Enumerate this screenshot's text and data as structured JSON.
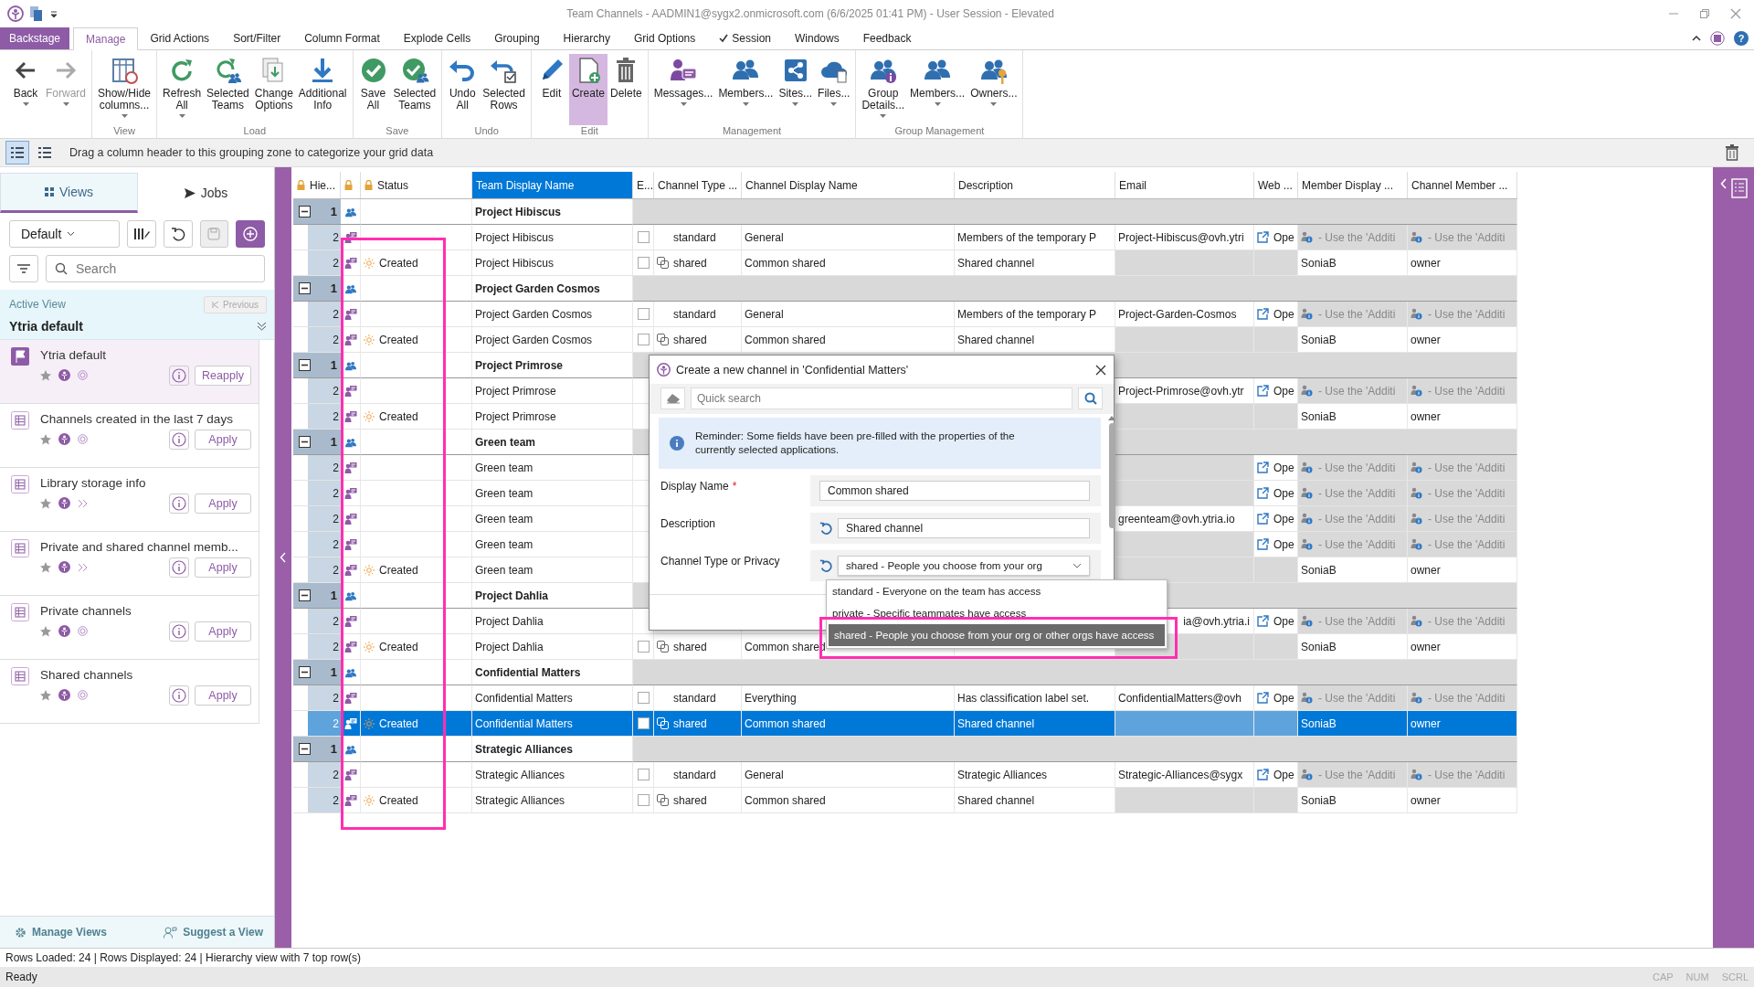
{
  "window": {
    "title": "Team Channels - AADMIN1@sygx2.onmicrosoft.com (6/6/2025 01:41 PM) - User Session - Elevated"
  },
  "menu_tabs": [
    {
      "label": "Backstage",
      "kind": "backstage"
    },
    {
      "label": "Manage",
      "kind": "tab",
      "selected": true
    },
    {
      "label": "Grid Actions",
      "kind": "tab",
      "selected": false
    },
    {
      "label": "Sort/Filter",
      "kind": "tab",
      "selected": false
    },
    {
      "label": "Column Format",
      "kind": "tab",
      "selected": false
    },
    {
      "label": "Explode Cells",
      "kind": "tab",
      "selected": false
    },
    {
      "label": "Grouping",
      "kind": "tab",
      "selected": false
    },
    {
      "label": "Hierarchy",
      "kind": "tab",
      "selected": false
    },
    {
      "label": "Grid Options",
      "kind": "tab",
      "selected": false
    },
    {
      "label": "Session",
      "kind": "toggle",
      "checked": true,
      "selected": false
    },
    {
      "label": "Windows",
      "kind": "tab",
      "selected": false
    },
    {
      "label": "Feedback",
      "kind": "tab",
      "selected": false
    }
  ],
  "help_button": "?",
  "ribbon": {
    "groups": [
      {
        "buttons": [
          {
            "label": "Back",
            "dropdown": true,
            "disabled": false,
            "selected": false
          },
          {
            "label": "Forward",
            "dropdown": true,
            "disabled": true,
            "selected": false
          }
        ]
      },
      {
        "label": "View",
        "buttons": [
          {
            "label": "Show/Hide\ncolumns...",
            "dropdown": true,
            "disabled": false,
            "selected": false
          }
        ]
      },
      {
        "label": "Load",
        "buttons": [
          {
            "label": "Refresh\nAll",
            "dropdown": true,
            "disabled": false,
            "selected": false
          },
          {
            "label": "Selected\nTeams",
            "dropdown": false,
            "disabled": false,
            "selected": false
          },
          {
            "label": "Change\nOptions",
            "dropdown": false,
            "disabled": false,
            "selected": false
          },
          {
            "label": "Additional\nInfo",
            "dropdown": false,
            "disabled": false,
            "selected": false
          }
        ]
      },
      {
        "label": "Save",
        "buttons": [
          {
            "label": "Save\nAll",
            "dropdown": false,
            "disabled": false,
            "selected": false
          },
          {
            "label": "Selected\nTeams",
            "dropdown": false,
            "disabled": false,
            "selected": false
          }
        ]
      },
      {
        "label": "Undo",
        "buttons": [
          {
            "label": "Undo\nAll",
            "dropdown": false,
            "disabled": false,
            "selected": false
          },
          {
            "label": "Selected\nRows",
            "dropdown": false,
            "disabled": false,
            "selected": false
          }
        ]
      },
      {
        "label": "Edit",
        "buttons": [
          {
            "label": "Edit",
            "dropdown": false,
            "disabled": false,
            "selected": false
          },
          {
            "label": "Create",
            "dropdown": false,
            "disabled": false,
            "selected": true
          },
          {
            "label": "Delete",
            "dropdown": false,
            "disabled": false,
            "selected": false
          }
        ]
      },
      {
        "label": "Management",
        "buttons": [
          {
            "label": "Messages...",
            "dropdown": true,
            "disabled": false,
            "selected": false
          },
          {
            "label": "Members...",
            "dropdown": true,
            "disabled": false,
            "selected": false
          },
          {
            "label": "Sites...",
            "dropdown": true,
            "disabled": false,
            "selected": false
          },
          {
            "label": "Files...",
            "dropdown": true,
            "disabled": false,
            "selected": false
          }
        ]
      },
      {
        "label": "Group Management",
        "buttons": [
          {
            "label": "Group\nDetails...",
            "dropdown": true,
            "disabled": false,
            "selected": false
          },
          {
            "label": "Members...",
            "dropdown": true,
            "disabled": false,
            "selected": false
          },
          {
            "label": "Owners...",
            "dropdown": true,
            "disabled": false,
            "selected": false
          }
        ]
      }
    ]
  },
  "grouping_zone": {
    "hint": "Drag a column header to this grouping zone to categorize your grid data",
    "layouts": [
      {
        "selected": true
      },
      {
        "selected": false
      }
    ]
  },
  "side_panel": {
    "tabs": [
      {
        "label": "Views",
        "selected": true
      },
      {
        "label": "Jobs",
        "selected": false
      }
    ],
    "view_select": "Default",
    "search": {
      "placeholder": "Search"
    },
    "active_view": {
      "caption": "Active View",
      "previous": {
        "label": "Previous",
        "disabled": true
      },
      "name": "Ytria default"
    },
    "views": [
      {
        "title": "Ytria default",
        "active": true,
        "button": "Reapply"
      },
      {
        "title": "Channels created in the last 7 days",
        "active": false,
        "button": "Apply"
      },
      {
        "title": "Library storage info",
        "active": false,
        "button": "Apply"
      },
      {
        "title": "Private and shared channel memb...",
        "active": false,
        "button": "Apply"
      },
      {
        "title": "Private channels",
        "active": false,
        "button": "Apply"
      },
      {
        "title": "Shared channels",
        "active": false,
        "button": "Apply"
      }
    ],
    "footer": {
      "manage": "Manage Views",
      "suggest": "Suggest a View"
    }
  },
  "grid": {
    "columns": [
      {
        "label": "Hie...",
        "locked": true,
        "selected": false
      },
      {
        "locked": true,
        "selected": false
      },
      {
        "label": "Status",
        "locked": true,
        "selected": false,
        "highlighted": true
      },
      {
        "label": "Team Display Name",
        "locked": false,
        "selected": true
      },
      {
        "label": "E...",
        "locked": false,
        "selected": false
      },
      {
        "label": "Channel Type ...",
        "locked": false,
        "selected": false
      },
      {
        "label": "Channel Display Name",
        "locked": false,
        "selected": false
      },
      {
        "label": "Description",
        "locked": false,
        "selected": false
      },
      {
        "label": "Email",
        "locked": false,
        "selected": false
      },
      {
        "label": "Web ...",
        "locked": false,
        "selected": false
      },
      {
        "label": "Member Display ...",
        "locked": false,
        "selected": false
      },
      {
        "label": "Channel Member ...",
        "locked": false,
        "selected": false
      }
    ],
    "rows": [
      {
        "kind": "team",
        "level": "1",
        "expanded": true,
        "selected": false,
        "team": "Project Hibiscus"
      },
      {
        "kind": "channel",
        "level": "2",
        "selected": false,
        "team": "Project Hibiscus",
        "checked": false,
        "linked": false,
        "channel_type": "standard",
        "channel_name": "General",
        "description": "Members of the temporary P",
        "email": "Project-Hibiscus@ovh.ytri",
        "web": "Ope",
        "member": {
          "kind": "hint",
          "text": "- Use the 'Additi"
        },
        "role": {
          "kind": "hint",
          "text": "- Use the 'Additi"
        }
      },
      {
        "kind": "channel",
        "level": "2",
        "selected": false,
        "status": "Created",
        "team": "Project Hibiscus",
        "checked": false,
        "linked": true,
        "channel_type": "shared",
        "channel_name": "Common shared",
        "description": "Shared channel",
        "member": {
          "kind": "value",
          "text": "SoniaB"
        },
        "role": {
          "kind": "value",
          "text": "owner"
        }
      },
      {
        "kind": "team",
        "level": "1",
        "expanded": true,
        "selected": false,
        "team": "Project Garden Cosmos"
      },
      {
        "kind": "channel",
        "level": "2",
        "selected": false,
        "team": "Project Garden Cosmos",
        "checked": false,
        "linked": false,
        "channel_type": "standard",
        "channel_name": "General",
        "description": "Members of the temporary P",
        "email": "Project-Garden-Cosmos",
        "web": "Ope",
        "member": {
          "kind": "hint",
          "text": "- Use the 'Additi"
        },
        "role": {
          "kind": "hint",
          "text": "- Use the 'Additi"
        }
      },
      {
        "kind": "channel",
        "level": "2",
        "selected": false,
        "status": "Created",
        "team": "Project Garden Cosmos",
        "checked": false,
        "linked": true,
        "channel_type": "shared",
        "channel_name": "Common shared",
        "description": "Shared channel",
        "member": {
          "kind": "value",
          "text": "SoniaB"
        },
        "role": {
          "kind": "value",
          "text": "owner"
        }
      },
      {
        "kind": "team",
        "level": "1",
        "expanded": true,
        "selected": false,
        "team": "Project Primrose"
      },
      {
        "kind": "channel",
        "level": "2",
        "selected": false,
        "team": "Project Primrose",
        "email": "Project-Primrose@ovh.ytr",
        "web": "Ope",
        "member": {
          "kind": "hint",
          "text": "- Use the 'Additi"
        },
        "role": {
          "kind": "hint",
          "text": "- Use the 'Additi"
        }
      },
      {
        "kind": "channel",
        "level": "2",
        "selected": false,
        "status": "Created",
        "team": "Project Primrose",
        "member": {
          "kind": "value",
          "text": "SoniaB"
        },
        "role": {
          "kind": "value",
          "text": "owner"
        }
      },
      {
        "kind": "team",
        "level": "1",
        "expanded": true,
        "selected": false,
        "team": "Green team"
      },
      {
        "kind": "channel",
        "level": "2",
        "selected": false,
        "team": "Green team",
        "web": "Ope",
        "member": {
          "kind": "hint",
          "text": "- Use the 'Additi"
        },
        "role": {
          "kind": "hint",
          "text": "- Use the 'Additi"
        }
      },
      {
        "kind": "channel",
        "level": "2",
        "selected": false,
        "team": "Green team",
        "web": "Ope",
        "member": {
          "kind": "hint",
          "text": "- Use the 'Additi"
        },
        "role": {
          "kind": "hint",
          "text": "- Use the 'Additi"
        }
      },
      {
        "kind": "channel",
        "level": "2",
        "selected": false,
        "team": "Green team",
        "email": "greenteam@ovh.ytria.io",
        "web": "Ope",
        "member": {
          "kind": "hint",
          "text": "- Use the 'Additi"
        },
        "role": {
          "kind": "hint",
          "text": "- Use the 'Additi"
        }
      },
      {
        "kind": "channel",
        "level": "2",
        "selected": false,
        "team": "Green team",
        "web": "Ope",
        "member": {
          "kind": "hint",
          "text": "- Use the 'Additi"
        },
        "role": {
          "kind": "hint",
          "text": "- Use the 'Additi"
        }
      },
      {
        "kind": "channel",
        "level": "2",
        "selected": false,
        "status": "Created",
        "team": "Green team",
        "member": {
          "kind": "value",
          "text": "SoniaB"
        },
        "role": {
          "kind": "value",
          "text": "owner"
        }
      },
      {
        "kind": "team",
        "level": "1",
        "expanded": true,
        "selected": false,
        "team": "Project Dahlia"
      },
      {
        "kind": "channel",
        "level": "2",
        "selected": false,
        "team": "Project Dahlia",
        "email": "ia@ovh.ytria.i",
        "email_cut_start": true,
        "web": "Ope",
        "member": {
          "kind": "hint",
          "text": "- Use the 'Additi"
        },
        "role": {
          "kind": "hint",
          "text": "- Use the 'Additi"
        }
      },
      {
        "kind": "channel",
        "level": "2",
        "selected": false,
        "status": "Created",
        "team": "Project Dahlia",
        "checked": false,
        "linked": true,
        "channel_type": "shared",
        "channel_name": "Common shared",
        "member": {
          "kind": "value",
          "text": "SoniaB"
        },
        "role": {
          "kind": "value",
          "text": "owner"
        }
      },
      {
        "kind": "team",
        "level": "1",
        "expanded": true,
        "selected": false,
        "team": "Confidential Matters"
      },
      {
        "kind": "channel",
        "level": "2",
        "selected": false,
        "team": "Confidential Matters",
        "checked": false,
        "linked": false,
        "channel_type": "standard",
        "channel_name": "Everything",
        "description": "Has classification label set.",
        "email": "ConfidentialMatters@ovh",
        "web": "Ope",
        "member": {
          "kind": "hint",
          "text": "- Use the 'Additi"
        },
        "role": {
          "kind": "hint",
          "text": "- Use the 'Additi"
        }
      },
      {
        "kind": "channel",
        "level": "2",
        "selected": true,
        "status": "Created",
        "team": "Confidential Matters",
        "checked": false,
        "linked": true,
        "channel_type": "shared",
        "channel_name": "Common shared",
        "description": "Shared channel",
        "member": {
          "kind": "value",
          "text": "SoniaB"
        },
        "role": {
          "kind": "value",
          "text": "owner"
        }
      },
      {
        "kind": "team",
        "level": "1",
        "expanded": true,
        "selected": false,
        "team": "Strategic Alliances"
      },
      {
        "kind": "channel",
        "level": "2",
        "selected": false,
        "team": "Strategic Alliances",
        "checked": false,
        "linked": false,
        "channel_type": "standard",
        "channel_name": "General",
        "description": "Strategic Alliances",
        "email": "Strategic-Alliances@sygx",
        "web": "Ope",
        "member": {
          "kind": "hint",
          "text": "- Use the 'Additi"
        },
        "role": {
          "kind": "hint",
          "text": "- Use the 'Additi"
        }
      },
      {
        "kind": "channel",
        "level": "2",
        "selected": false,
        "status": "Created",
        "team": "Strategic Alliances",
        "checked": false,
        "linked": true,
        "channel_type": "shared",
        "channel_name": "Common shared",
        "description": "Shared channel",
        "member": {
          "kind": "value",
          "text": "SoniaB"
        },
        "role": {
          "kind": "value",
          "text": "owner"
        }
      }
    ]
  },
  "dialog": {
    "title": "Create a new channel in 'Confidential Matters'",
    "search": {
      "placeholder": "Quick search"
    },
    "notice": "Reminder: Some fields have been pre-filled with the properties of the currently selected applications.",
    "fields": [
      {
        "kind": "text",
        "label": "Display Name",
        "marker": "*",
        "resettable": false,
        "value": "Common shared"
      },
      {
        "kind": "text",
        "label": "Description",
        "resettable": true,
        "value": "Shared channel"
      },
      {
        "kind": "select",
        "label": "Channel Type or Privacy",
        "resettable": true,
        "value": "shared - People you choose from your org"
      }
    ],
    "options": [
      {
        "label": "standard - Everyone on the team has access",
        "selected": false,
        "highlighted": false
      },
      {
        "label": "private - Specific teammates have access",
        "selected": false,
        "highlighted": false
      },
      {
        "label": "shared - People you choose from your org or other orgs have access",
        "selected": true,
        "highlighted": true
      }
    ]
  },
  "status_bar": {
    "summary": "Rows Loaded: 24 | Rows Displayed: 24 | Hierarchy view with 7 top row(s)",
    "state": "Ready",
    "indicators": [
      {
        "label": "CAP",
        "on": false
      },
      {
        "label": "NUM",
        "on": false
      },
      {
        "label": "SCRL",
        "on": false
      }
    ]
  }
}
